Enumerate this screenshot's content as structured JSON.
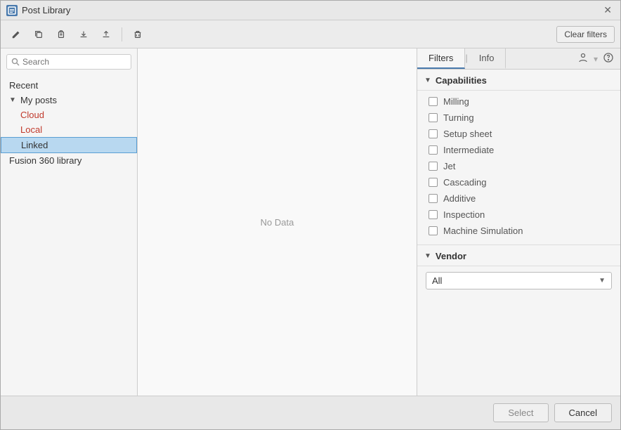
{
  "dialog": {
    "title": "Post Library",
    "close_label": "✕"
  },
  "toolbar": {
    "buttons": [
      {
        "id": "edit",
        "icon": "✏",
        "label": "Edit",
        "disabled": false
      },
      {
        "id": "copy",
        "icon": "⎘",
        "label": "Copy",
        "disabled": false
      },
      {
        "id": "paste",
        "icon": "📋",
        "label": "Paste",
        "disabled": false
      },
      {
        "id": "import",
        "icon": "⬇",
        "label": "Import",
        "disabled": false
      },
      {
        "id": "export",
        "icon": "⬆",
        "label": "Export",
        "disabled": false
      },
      {
        "id": "delete",
        "icon": "🗑",
        "label": "Delete",
        "disabled": false
      }
    ],
    "clear_filters_label": "Clear filters"
  },
  "sidebar": {
    "search_placeholder": "Search",
    "items": [
      {
        "id": "recent",
        "label": "Recent",
        "level": 0,
        "type": "plain"
      },
      {
        "id": "my-posts",
        "label": "My posts",
        "level": 0,
        "type": "parent",
        "expanded": true
      },
      {
        "id": "cloud",
        "label": "Cloud",
        "level": 1,
        "type": "child-red"
      },
      {
        "id": "local",
        "label": "Local",
        "level": 1,
        "type": "child-red"
      },
      {
        "id": "linked",
        "label": "Linked",
        "level": 1,
        "type": "child-selected"
      },
      {
        "id": "fusion-library",
        "label": "Fusion 360 library",
        "level": 0,
        "type": "plain"
      }
    ]
  },
  "center": {
    "no_data_label": "No Data"
  },
  "right_panel": {
    "tabs": [
      {
        "id": "filters",
        "label": "Filters",
        "active": true
      },
      {
        "id": "info",
        "label": "Info",
        "active": false
      }
    ],
    "capabilities_section": {
      "label": "Capabilities",
      "items": [
        {
          "id": "milling",
          "label": "Milling",
          "checked": false
        },
        {
          "id": "turning",
          "label": "Turning",
          "checked": false
        },
        {
          "id": "setup-sheet",
          "label": "Setup sheet",
          "checked": false
        },
        {
          "id": "intermediate",
          "label": "Intermediate",
          "checked": false
        },
        {
          "id": "jet",
          "label": "Jet",
          "checked": false
        },
        {
          "id": "cascading",
          "label": "Cascading",
          "checked": false
        },
        {
          "id": "additive",
          "label": "Additive",
          "checked": false
        },
        {
          "id": "inspection",
          "label": "Inspection",
          "checked": false
        },
        {
          "id": "machine-simulation",
          "label": "Machine Simulation",
          "checked": false
        }
      ]
    },
    "vendor_section": {
      "label": "Vendor",
      "dropdown_value": "All",
      "dropdown_options": [
        "All"
      ]
    },
    "panel_icons": [
      {
        "id": "help-account",
        "icon": "👤"
      },
      {
        "id": "help",
        "icon": "?"
      }
    ]
  },
  "bottom": {
    "select_label": "Select",
    "cancel_label": "Cancel"
  }
}
